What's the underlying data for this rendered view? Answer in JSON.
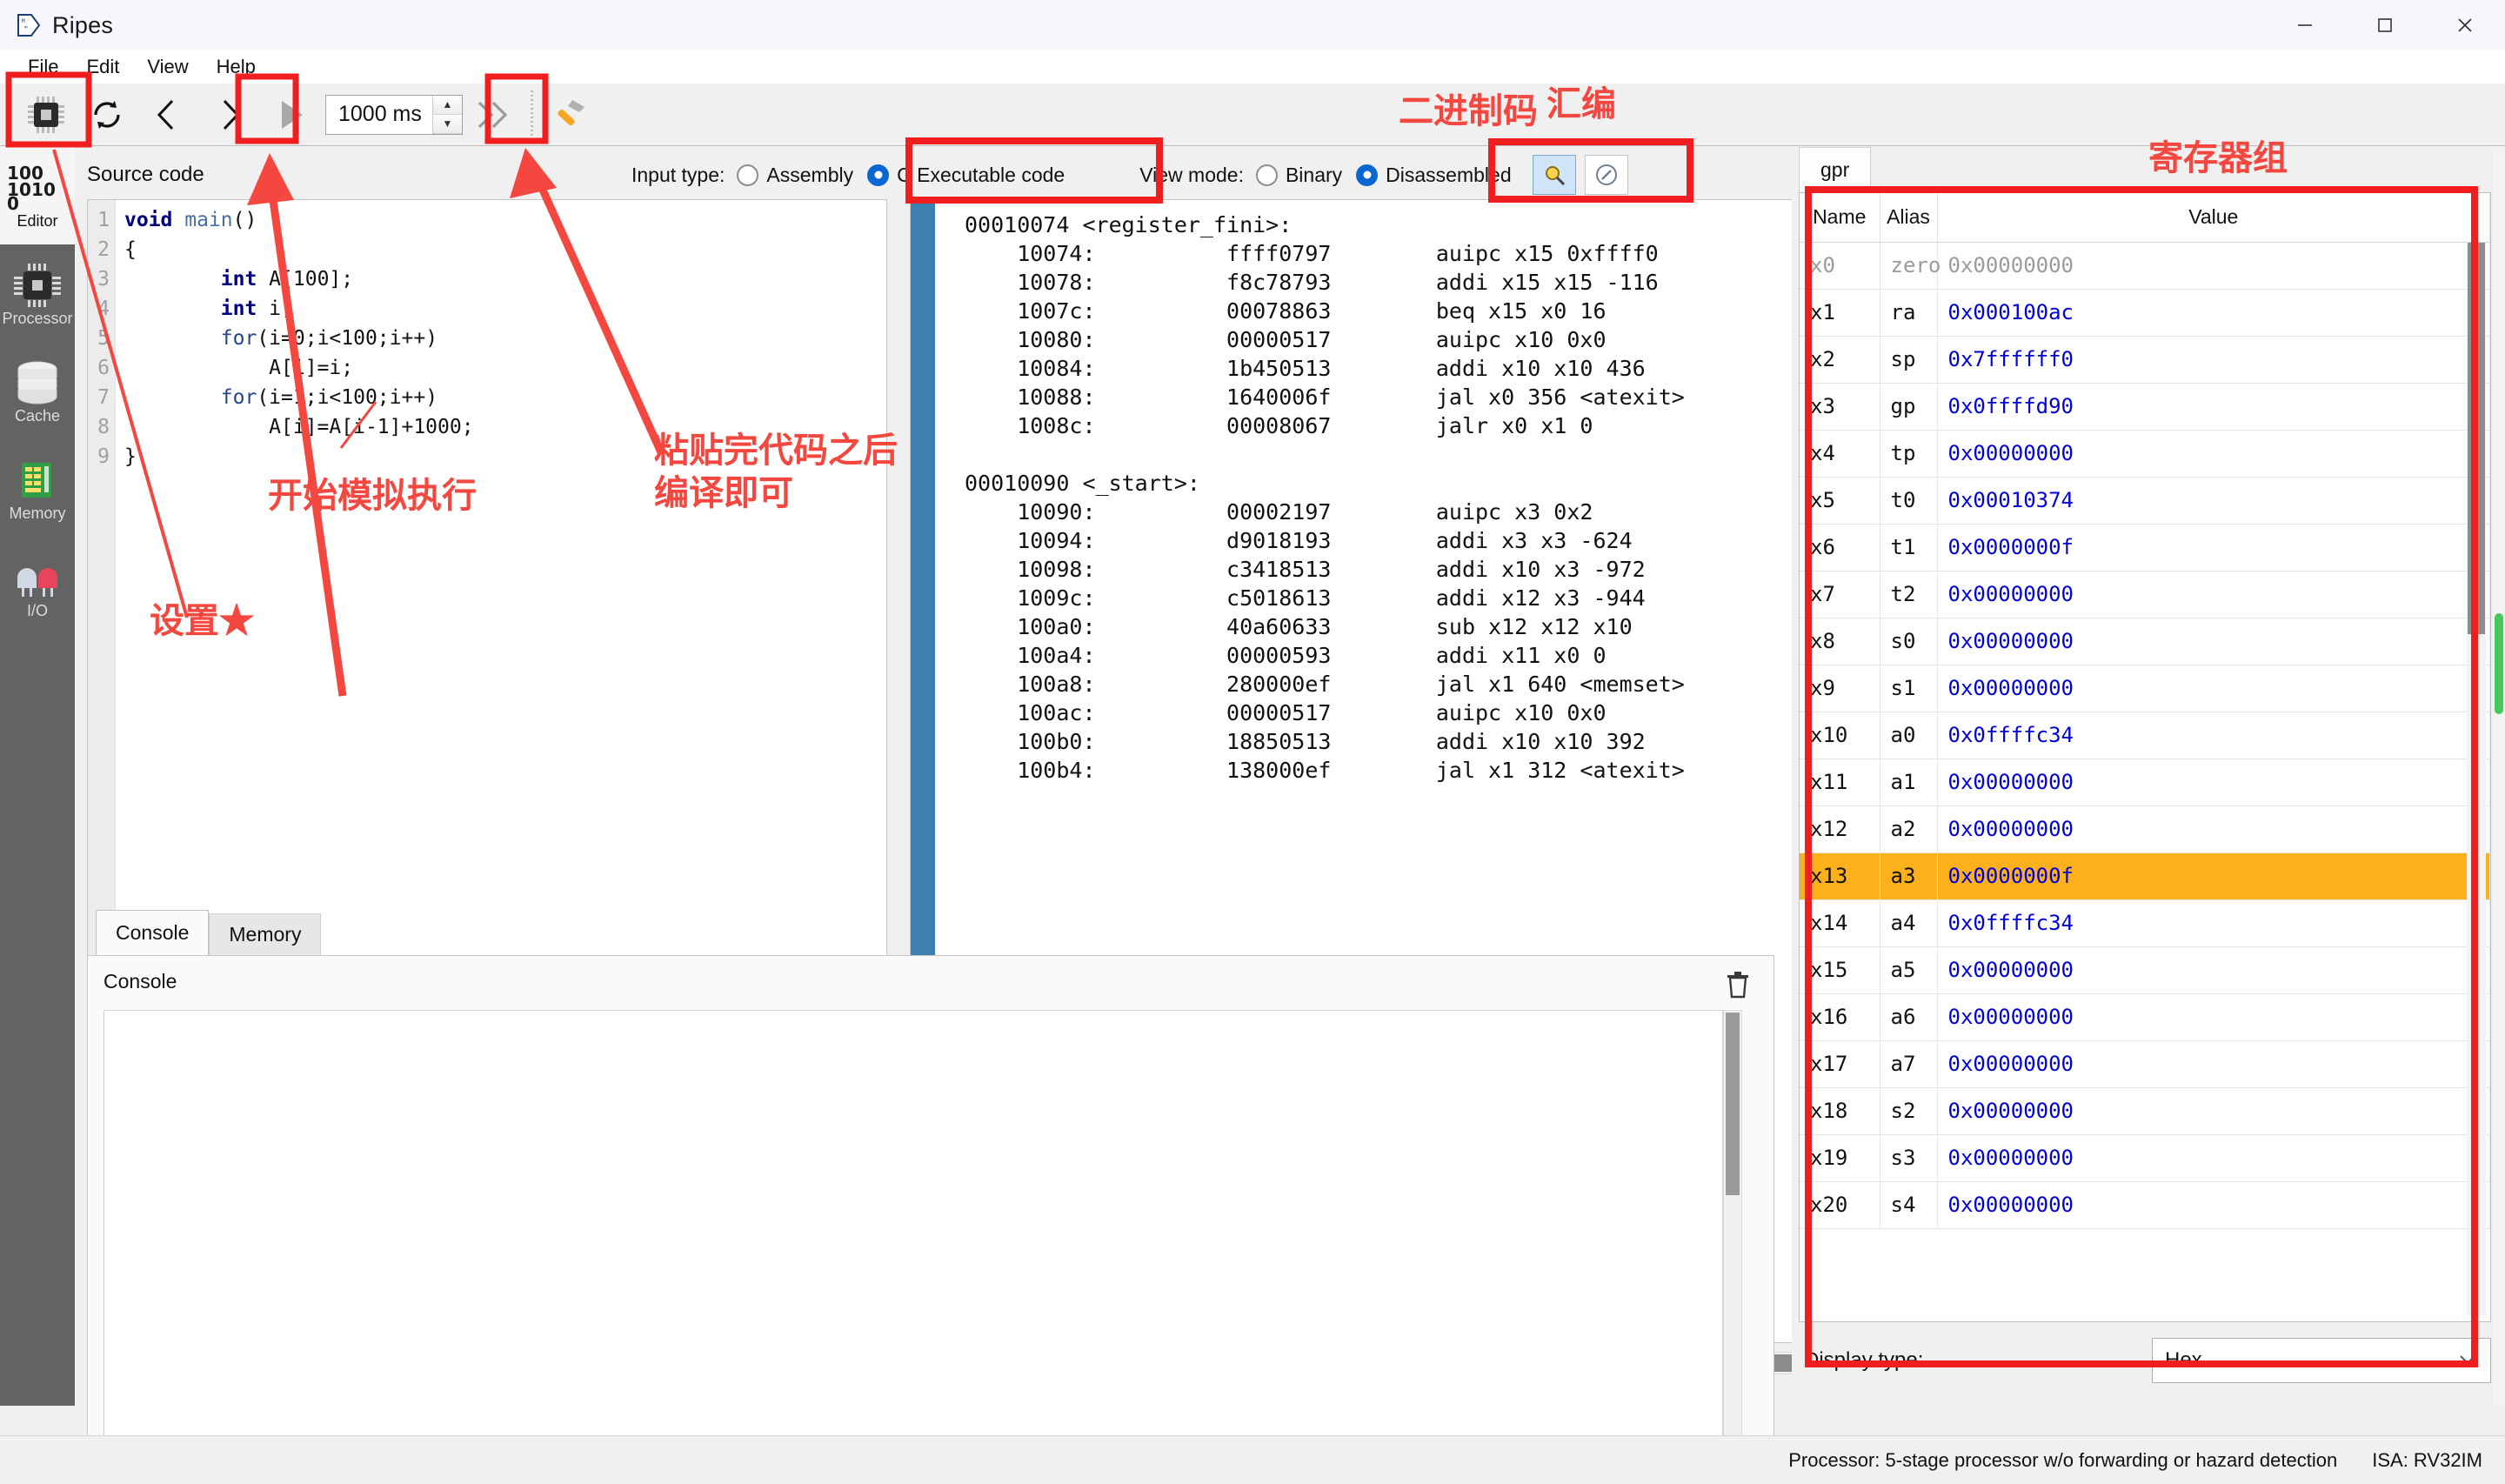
{
  "window": {
    "title": "Ripes",
    "app_icon": "ripes-logo-icon",
    "minimize": "─",
    "maximize": "☐",
    "close": "✕"
  },
  "menu": {
    "items": [
      "File",
      "Edit",
      "View",
      "Help"
    ]
  },
  "toolbar": {
    "reset_icon": "chip-reset-icon",
    "reload_icon": "reload-icon",
    "prev_icon": "step-back-icon",
    "next_icon": "step-forward-icon",
    "run_icon": "play-icon",
    "speed_value": "1000 ms",
    "spin_up": "▲",
    "spin_down": "▼",
    "fastforward_icon": "fast-forward-icon",
    "build_icon": "hammer-build-icon"
  },
  "sidebar": {
    "items": [
      {
        "label": "Editor",
        "icon": "binary-editor-icon",
        "active": true
      },
      {
        "label": "Processor",
        "icon": "chip-processor-icon",
        "active": false
      },
      {
        "label": "Cache",
        "icon": "database-cache-icon",
        "active": false
      },
      {
        "label": "Memory",
        "icon": "ram-memory-icon",
        "active": false
      },
      {
        "label": "I/O",
        "icon": "led-io-icon",
        "active": false
      }
    ]
  },
  "editor": {
    "source_label": "Source code",
    "input_type_label": "Input type:",
    "input_options": [
      {
        "label": "Assembly",
        "selected": false
      },
      {
        "label": "C  Executable code",
        "selected": true
      }
    ],
    "view_mode_label": "View mode:",
    "view_options": [
      {
        "label": "Binary",
        "selected": false
      },
      {
        "label": "Disassembled",
        "selected": true
      }
    ],
    "magnifier_icon": "magnifier-icon",
    "compass_icon": "compass-icon",
    "code_lines": [
      {
        "n": "1",
        "text": "void main()"
      },
      {
        "n": "2",
        "text": "{"
      },
      {
        "n": "3",
        "text": "        int A[100];"
      },
      {
        "n": "4",
        "text": "        int i;"
      },
      {
        "n": "5",
        "text": "        for(i=0;i<100;i++)"
      },
      {
        "n": "6",
        "text": "            A[i]=i;"
      },
      {
        "n": "7",
        "text": "        for(i=1;i<100;i++)"
      },
      {
        "n": "8",
        "text": "            A[i]=A[i-1]+1000;"
      },
      {
        "n": "9",
        "text": "}"
      }
    ],
    "disassembly": [
      {
        "type": "label",
        "text": "00010074 <register_fini>:"
      },
      {
        "type": "insn",
        "addr": "10074:",
        "word": "ffff0797",
        "asm": "auipc x15 0xffff0"
      },
      {
        "type": "insn",
        "addr": "10078:",
        "word": "f8c78793",
        "asm": "addi x15 x15 -116"
      },
      {
        "type": "insn",
        "addr": "1007c:",
        "word": "00078863",
        "asm": "beq x15 x0 16"
      },
      {
        "type": "insn",
        "addr": "10080:",
        "word": "00000517",
        "asm": "auipc x10 0x0"
      },
      {
        "type": "insn",
        "addr": "10084:",
        "word": "1b450513",
        "asm": "addi x10 x10 436"
      },
      {
        "type": "insn",
        "addr": "10088:",
        "word": "1640006f",
        "asm": "jal x0 356 <atexit>"
      },
      {
        "type": "insn",
        "addr": "1008c:",
        "word": "00008067",
        "asm": "jalr x0 x1 0"
      },
      {
        "type": "blank",
        "text": ""
      },
      {
        "type": "label",
        "text": "00010090 <_start>:"
      },
      {
        "type": "insn",
        "addr": "10090:",
        "word": "00002197",
        "asm": "auipc x3 0x2"
      },
      {
        "type": "insn",
        "addr": "10094:",
        "word": "d9018193",
        "asm": "addi x3 x3 -624"
      },
      {
        "type": "insn",
        "addr": "10098:",
        "word": "c3418513",
        "asm": "addi x10 x3 -972"
      },
      {
        "type": "insn",
        "addr": "1009c:",
        "word": "c5018613",
        "asm": "addi x12 x3 -944"
      },
      {
        "type": "insn",
        "addr": "100a0:",
        "word": "40a60633",
        "asm": "sub x12 x12 x10"
      },
      {
        "type": "insn",
        "addr": "100a4:",
        "word": "00000593",
        "asm": "addi x11 x0 0"
      },
      {
        "type": "insn",
        "addr": "100a8:",
        "word": "280000ef",
        "asm": "jal x1 640 <memset>"
      },
      {
        "type": "insn",
        "addr": "100ac:",
        "word": "00000517",
        "asm": "auipc x10 0x0"
      },
      {
        "type": "insn",
        "addr": "100b0:",
        "word": "18850513",
        "asm": "addi x10 x10 392"
      },
      {
        "type": "insn",
        "addr": "100b4:",
        "word": "138000ef",
        "asm": "jal x1 312 <atexit>"
      }
    ]
  },
  "console": {
    "tabs": [
      {
        "label": "Console",
        "active": true
      },
      {
        "label": "Memory",
        "active": false
      }
    ],
    "heading": "Console",
    "clear_icon": "trash-icon",
    "output": ""
  },
  "registers": {
    "tab_label": "gpr",
    "columns": [
      "Name",
      "Alias",
      "Value"
    ],
    "rows": [
      {
        "name": "x0",
        "alias": "zero",
        "value": "0x00000000",
        "dim": true,
        "selected": false
      },
      {
        "name": "x1",
        "alias": "ra",
        "value": "0x000100ac",
        "dim": false,
        "selected": false
      },
      {
        "name": "x2",
        "alias": "sp",
        "value": "0x7ffffff0",
        "dim": false,
        "selected": false
      },
      {
        "name": "x3",
        "alias": "gp",
        "value": "0x0ffffd90",
        "dim": false,
        "selected": false
      },
      {
        "name": "x4",
        "alias": "tp",
        "value": "0x00000000",
        "dim": false,
        "selected": false
      },
      {
        "name": "x5",
        "alias": "t0",
        "value": "0x00010374",
        "dim": false,
        "selected": false
      },
      {
        "name": "x6",
        "alias": "t1",
        "value": "0x0000000f",
        "dim": false,
        "selected": false
      },
      {
        "name": "x7",
        "alias": "t2",
        "value": "0x00000000",
        "dim": false,
        "selected": false
      },
      {
        "name": "x8",
        "alias": "s0",
        "value": "0x00000000",
        "dim": false,
        "selected": false
      },
      {
        "name": "x9",
        "alias": "s1",
        "value": "0x00000000",
        "dim": false,
        "selected": false
      },
      {
        "name": "x10",
        "alias": "a0",
        "value": "0x0ffffc34",
        "dim": false,
        "selected": false
      },
      {
        "name": "x11",
        "alias": "a1",
        "value": "0x00000000",
        "dim": false,
        "selected": false
      },
      {
        "name": "x12",
        "alias": "a2",
        "value": "0x00000000",
        "dim": false,
        "selected": false
      },
      {
        "name": "x13",
        "alias": "a3",
        "value": "0x0000000f",
        "dim": false,
        "selected": true
      },
      {
        "name": "x14",
        "alias": "a4",
        "value": "0x0ffffc34",
        "dim": false,
        "selected": false
      },
      {
        "name": "x15",
        "alias": "a5",
        "value": "0x00000000",
        "dim": false,
        "selected": false
      },
      {
        "name": "x16",
        "alias": "a6",
        "value": "0x00000000",
        "dim": false,
        "selected": false
      },
      {
        "name": "x17",
        "alias": "a7",
        "value": "0x00000000",
        "dim": false,
        "selected": false
      },
      {
        "name": "x18",
        "alias": "s2",
        "value": "0x00000000",
        "dim": false,
        "selected": false
      },
      {
        "name": "x19",
        "alias": "s3",
        "value": "0x00000000",
        "dim": false,
        "selected": false
      },
      {
        "name": "x20",
        "alias": "s4",
        "value": "0x00000000",
        "dim": false,
        "selected": false
      }
    ],
    "display_type_label": "Display type:",
    "display_type_value": "Hex",
    "chevron": "⌄"
  },
  "statusbar": {
    "processor": "Processor: 5-stage processor w/o forwarding or hazard detection",
    "isa": "ISA: RV32IM"
  },
  "annotations": {
    "color": "#f4473f",
    "texts": [
      {
        "id": "binary-code-note",
        "text": "二进制码"
      },
      {
        "id": "assembly-note",
        "text": "汇编"
      },
      {
        "id": "register-file-note",
        "text": "寄存器组"
      },
      {
        "id": "run-sim-note",
        "text": "开始模拟执行"
      },
      {
        "id": "compile-note",
        "text": "粘贴完代码之后\n编译即可"
      },
      {
        "id": "settings-note",
        "text": "设置★"
      }
    ]
  }
}
